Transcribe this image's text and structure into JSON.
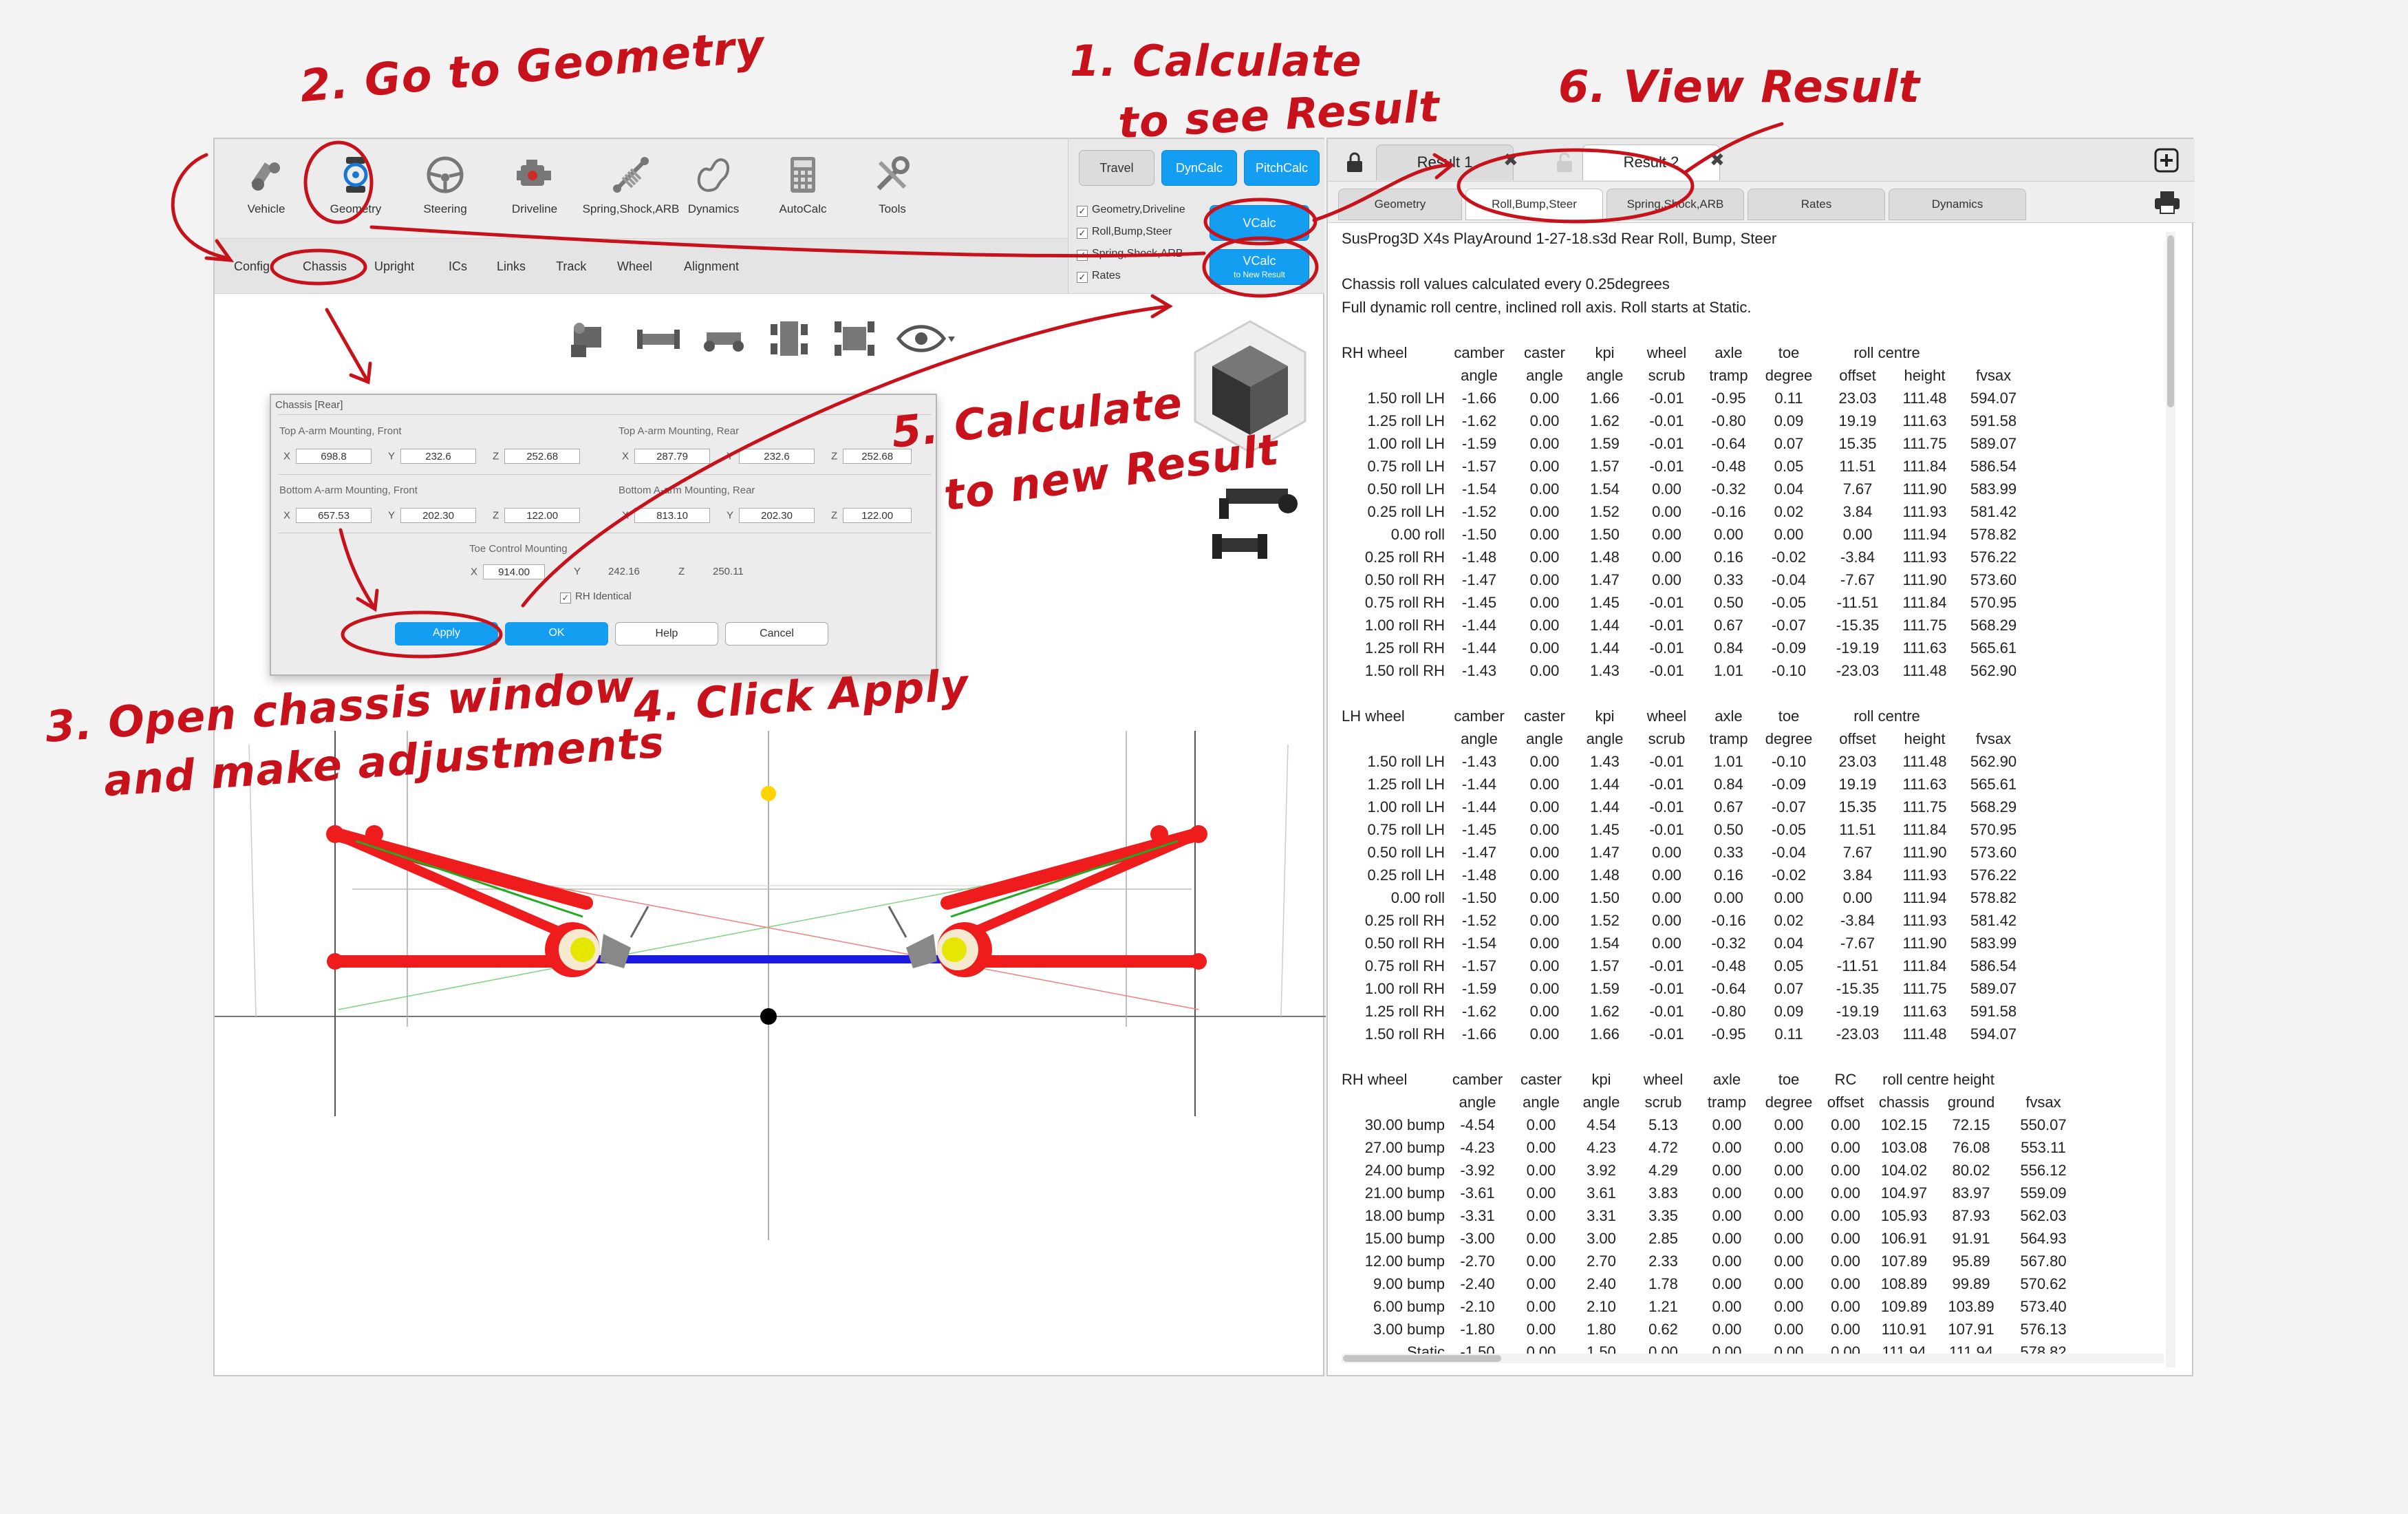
{
  "toolbar": {
    "tools": [
      {
        "label": "Vehicle",
        "icon": "vehicle-icon"
      },
      {
        "label": "Geometry",
        "icon": "geometry-icon"
      },
      {
        "label": "Steering",
        "icon": "steering-wheel-icon"
      },
      {
        "label": "Driveline",
        "icon": "engine-icon"
      },
      {
        "label": "Spring,Shock,ARB",
        "icon": "shock-icon"
      },
      {
        "label": "Dynamics",
        "icon": "track-icon"
      },
      {
        "label": "AutoCalc",
        "icon": "calculator-icon"
      },
      {
        "label": "Tools",
        "icon": "tools-icon"
      }
    ]
  },
  "subtabs": [
    "Config",
    "Chassis",
    "Upright",
    "ICs",
    "Links",
    "Track",
    "Wheel",
    "Alignment"
  ],
  "calc_panel": {
    "travel": "Travel",
    "dyncalc": "DynCalc",
    "pitchcalc": "PitchCalc",
    "vcalc": "VCalc",
    "vcalc_new": "VCalc",
    "vcalc_new_sub": "to New Result",
    "checks": [
      {
        "label": "Geometry,Driveline",
        "checked": true
      },
      {
        "label": "Roll,Bump,Steer",
        "checked": true
      },
      {
        "label": "Spring,Shock,ARB",
        "checked": true
      },
      {
        "label": "Rates",
        "checked": true
      }
    ]
  },
  "dialog": {
    "title": "Chassis [Rear]",
    "top_front": {
      "label": "Top A-arm Mounting, Front",
      "x": "698.8",
      "y": "232.6",
      "z": "252.68"
    },
    "top_rear": {
      "label": "Top A-arm Mounting, Rear",
      "x": "287.79",
      "y": "232.6",
      "z": "252.68"
    },
    "bottom_front": {
      "label": "Bottom A-arm Mounting, Front",
      "x": "657.53",
      "y": "202.30",
      "z": "122.00"
    },
    "bottom_rear": {
      "label": "Bottom A-arm Mounting, Rear",
      "x": "813.10",
      "y": "202.30",
      "z": "122.00"
    },
    "toe": {
      "label": "Toe Control Mounting",
      "x": "914.00",
      "y": "242.16",
      "z": "250.11"
    },
    "rh_identical": "RH Identical",
    "apply": "Apply",
    "ok": "OK",
    "help": "Help",
    "cancel": "Cancel"
  },
  "result_tabs": [
    {
      "label": "Result 1",
      "active": false
    },
    {
      "label": "Result 2",
      "active": true
    }
  ],
  "result_subtabs": [
    "Geometry",
    "Roll,Bump,Steer",
    "Spring,Shock,ARB",
    "Rates",
    "Dynamics"
  ],
  "result_text": {
    "header": "SusProg3D X4s PlayAround 1-27-18.s3d Rear Roll, Bump, Steer",
    "note1": "Chassis roll values calculated every 0.25degrees",
    "note2": "Full dynamic roll centre, inclined roll axis. Roll starts at Static.",
    "rh_roll": {
      "head1": [
        "RH wheel",
        "camber",
        "caster",
        "kpi",
        "wheel",
        "axle",
        "toe",
        "roll centre",
        ""
      ],
      "head2": [
        "",
        "angle",
        "angle",
        "angle",
        "scrub",
        "tramp",
        "degree",
        "offset",
        "height",
        "fvsax"
      ],
      "rows": [
        [
          "1.50 roll LH",
          "-1.66",
          "0.00",
          "1.66",
          "-0.01",
          "-0.95",
          "0.11",
          "23.03",
          "111.48",
          "594.07"
        ],
        [
          "1.25 roll LH",
          "-1.62",
          "0.00",
          "1.62",
          "-0.01",
          "-0.80",
          "0.09",
          "19.19",
          "111.63",
          "591.58"
        ],
        [
          "1.00 roll LH",
          "-1.59",
          "0.00",
          "1.59",
          "-0.01",
          "-0.64",
          "0.07",
          "15.35",
          "111.75",
          "589.07"
        ],
        [
          "0.75 roll LH",
          "-1.57",
          "0.00",
          "1.57",
          "-0.01",
          "-0.48",
          "0.05",
          "11.51",
          "111.84",
          "586.54"
        ],
        [
          "0.50 roll LH",
          "-1.54",
          "0.00",
          "1.54",
          "0.00",
          "-0.32",
          "0.04",
          "7.67",
          "111.90",
          "583.99"
        ],
        [
          "0.25 roll LH",
          "-1.52",
          "0.00",
          "1.52",
          "0.00",
          "-0.16",
          "0.02",
          "3.84",
          "111.93",
          "581.42"
        ],
        [
          "0.00 roll",
          "-1.50",
          "0.00",
          "1.50",
          "0.00",
          "0.00",
          "0.00",
          "0.00",
          "111.94",
          "578.82"
        ],
        [
          "0.25 roll RH",
          "-1.48",
          "0.00",
          "1.48",
          "0.00",
          "0.16",
          "-0.02",
          "-3.84",
          "111.93",
          "576.22"
        ],
        [
          "0.50 roll RH",
          "-1.47",
          "0.00",
          "1.47",
          "0.00",
          "0.33",
          "-0.04",
          "-7.67",
          "111.90",
          "573.60"
        ],
        [
          "0.75 roll RH",
          "-1.45",
          "0.00",
          "1.45",
          "-0.01",
          "0.50",
          "-0.05",
          "-11.51",
          "111.84",
          "570.95"
        ],
        [
          "1.00 roll RH",
          "-1.44",
          "0.00",
          "1.44",
          "-0.01",
          "0.67",
          "-0.07",
          "-15.35",
          "111.75",
          "568.29"
        ],
        [
          "1.25 roll RH",
          "-1.44",
          "0.00",
          "1.44",
          "-0.01",
          "0.84",
          "-0.09",
          "-19.19",
          "111.63",
          "565.61"
        ],
        [
          "1.50 roll RH",
          "-1.43",
          "0.00",
          "1.43",
          "-0.01",
          "1.01",
          "-0.10",
          "-23.03",
          "111.48",
          "562.90"
        ]
      ]
    },
    "lh_roll": {
      "head1": [
        "LH wheel",
        "camber",
        "caster",
        "kpi",
        "wheel",
        "axle",
        "toe",
        "roll centre",
        ""
      ],
      "head2": [
        "",
        "angle",
        "angle",
        "angle",
        "scrub",
        "tramp",
        "degree",
        "offset",
        "height",
        "fvsax"
      ],
      "rows": [
        [
          "1.50 roll LH",
          "-1.43",
          "0.00",
          "1.43",
          "-0.01",
          "1.01",
          "-0.10",
          "23.03",
          "111.48",
          "562.90"
        ],
        [
          "1.25 roll LH",
          "-1.44",
          "0.00",
          "1.44",
          "-0.01",
          "0.84",
          "-0.09",
          "19.19",
          "111.63",
          "565.61"
        ],
        [
          "1.00 roll LH",
          "-1.44",
          "0.00",
          "1.44",
          "-0.01",
          "0.67",
          "-0.07",
          "15.35",
          "111.75",
          "568.29"
        ],
        [
          "0.75 roll LH",
          "-1.45",
          "0.00",
          "1.45",
          "-0.01",
          "0.50",
          "-0.05",
          "11.51",
          "111.84",
          "570.95"
        ],
        [
          "0.50 roll LH",
          "-1.47",
          "0.00",
          "1.47",
          "0.00",
          "0.33",
          "-0.04",
          "7.67",
          "111.90",
          "573.60"
        ],
        [
          "0.25 roll LH",
          "-1.48",
          "0.00",
          "1.48",
          "0.00",
          "0.16",
          "-0.02",
          "3.84",
          "111.93",
          "576.22"
        ],
        [
          "0.00 roll",
          "-1.50",
          "0.00",
          "1.50",
          "0.00",
          "0.00",
          "0.00",
          "0.00",
          "111.94",
          "578.82"
        ],
        [
          "0.25 roll RH",
          "-1.52",
          "0.00",
          "1.52",
          "0.00",
          "-0.16",
          "0.02",
          "-3.84",
          "111.93",
          "581.42"
        ],
        [
          "0.50 roll RH",
          "-1.54",
          "0.00",
          "1.54",
          "0.00",
          "-0.32",
          "0.04",
          "-7.67",
          "111.90",
          "583.99"
        ],
        [
          "0.75 roll RH",
          "-1.57",
          "0.00",
          "1.57",
          "-0.01",
          "-0.48",
          "0.05",
          "-11.51",
          "111.84",
          "586.54"
        ],
        [
          "1.00 roll RH",
          "-1.59",
          "0.00",
          "1.59",
          "-0.01",
          "-0.64",
          "0.07",
          "-15.35",
          "111.75",
          "589.07"
        ],
        [
          "1.25 roll RH",
          "-1.62",
          "0.00",
          "1.62",
          "-0.01",
          "-0.80",
          "0.09",
          "-19.19",
          "111.63",
          "591.58"
        ],
        [
          "1.50 roll RH",
          "-1.66",
          "0.00",
          "1.66",
          "-0.01",
          "-0.95",
          "0.11",
          "-23.03",
          "111.48",
          "594.07"
        ]
      ]
    },
    "rh_bump": {
      "head1": [
        "RH wheel",
        "camber",
        "caster",
        "kpi",
        "wheel",
        "axle",
        "toe",
        "RC",
        "roll centre height",
        "",
        ""
      ],
      "head2": [
        "",
        "angle",
        "angle",
        "angle",
        "scrub",
        "tramp",
        "degree",
        "offset",
        "chassis",
        "ground",
        "fvsax"
      ],
      "rows": [
        [
          "30.00 bump",
          "-4.54",
          "0.00",
          "4.54",
          "5.13",
          "0.00",
          "0.00",
          "0.00",
          "102.15",
          "72.15",
          "550.07"
        ],
        [
          "27.00 bump",
          "-4.23",
          "0.00",
          "4.23",
          "4.72",
          "0.00",
          "0.00",
          "0.00",
          "103.08",
          "76.08",
          "553.11"
        ],
        [
          "24.00 bump",
          "-3.92",
          "0.00",
          "3.92",
          "4.29",
          "0.00",
          "0.00",
          "0.00",
          "104.02",
          "80.02",
          "556.12"
        ],
        [
          "21.00 bump",
          "-3.61",
          "0.00",
          "3.61",
          "3.83",
          "0.00",
          "0.00",
          "0.00",
          "104.97",
          "83.97",
          "559.09"
        ],
        [
          "18.00 bump",
          "-3.31",
          "0.00",
          "3.31",
          "3.35",
          "0.00",
          "0.00",
          "0.00",
          "105.93",
          "87.93",
          "562.03"
        ],
        [
          "15.00 bump",
          "-3.00",
          "0.00",
          "3.00",
          "2.85",
          "0.00",
          "0.00",
          "0.00",
          "106.91",
          "91.91",
          "564.93"
        ],
        [
          "12.00 bump",
          "-2.70",
          "0.00",
          "2.70",
          "2.33",
          "0.00",
          "0.00",
          "0.00",
          "107.89",
          "95.89",
          "567.80"
        ],
        [
          "9.00 bump",
          "-2.40",
          "0.00",
          "2.40",
          "1.78",
          "0.00",
          "0.00",
          "0.00",
          "108.89",
          "99.89",
          "570.62"
        ],
        [
          "6.00 bump",
          "-2.10",
          "0.00",
          "2.10",
          "1.21",
          "0.00",
          "0.00",
          "0.00",
          "109.89",
          "103.89",
          "573.40"
        ],
        [
          "3.00 bump",
          "-1.80",
          "0.00",
          "1.80",
          "0.62",
          "0.00",
          "0.00",
          "0.00",
          "110.91",
          "107.91",
          "576.13"
        ],
        [
          "Static",
          "-1.50",
          "0.00",
          "1.50",
          "0.00",
          "0.00",
          "0.00",
          "0.00",
          "111.94",
          "111.94",
          "578.82"
        ]
      ]
    }
  },
  "annotations": {
    "a1a": "1. Calculate",
    "a1b": "to see Result",
    "a2": "2. Go to Geometry",
    "a3a": "3. Open chassis window",
    "a3b": "and make adjustments",
    "a4": "4. Click Apply",
    "a5a": "5. Calculate",
    "a5b": "to new Result",
    "a6": "6. View Result"
  },
  "colors": {
    "accent_blue": "#139ef2",
    "annotation_red": "#c7121b",
    "suspension_red": "#ee1c1c",
    "axle_blue": "#1a1ae0"
  }
}
